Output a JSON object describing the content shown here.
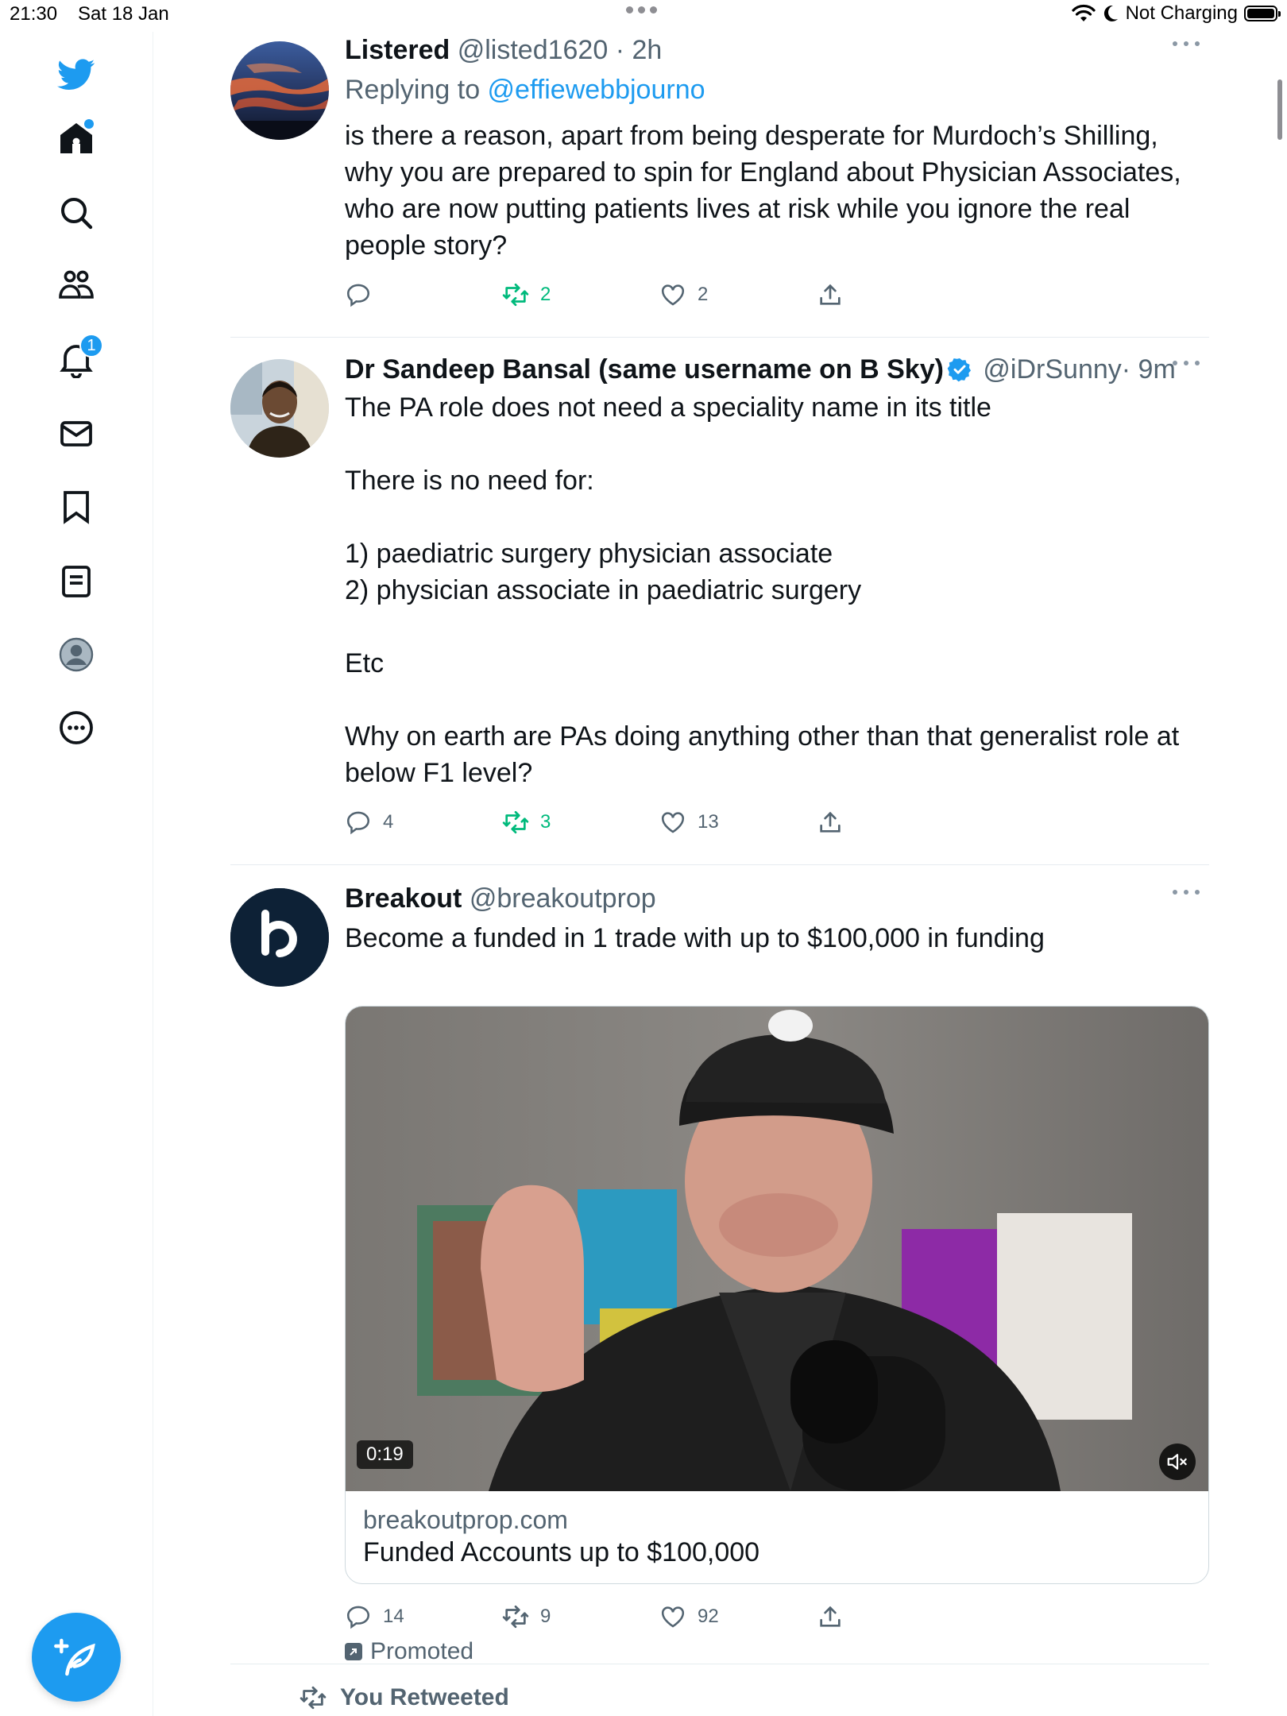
{
  "status_bar": {
    "time": "21:30",
    "date": "Sat 18 Jan",
    "battery": "Not Charging"
  },
  "sidebar": {
    "items": [
      {
        "name": "twitter-logo-icon"
      },
      {
        "name": "home-icon"
      },
      {
        "name": "search-icon"
      },
      {
        "name": "communities-icon"
      },
      {
        "name": "notifications-icon",
        "badge": "1"
      },
      {
        "name": "messages-icon"
      },
      {
        "name": "bookmarks-icon"
      },
      {
        "name": "lists-icon"
      },
      {
        "name": "profile-icon"
      },
      {
        "name": "more-icon"
      }
    ]
  },
  "colors": {
    "accent": "#1d9bf0",
    "retweet": "#00ba7c",
    "muted": "#536471"
  },
  "tweets": [
    {
      "name": "Listered",
      "handle": "@listed1620",
      "time": "· 2h",
      "replying_prefix": "Replying to ",
      "replying_to": "@effiewebbjourno",
      "text": "is there a reason, apart from being desperate for Murdoch’s Shilling, why you are prepared to spin for England about Physician Associates, who are now putting patients lives at risk while you ignore the real people story?",
      "replies": "",
      "retweets": "2",
      "likes": "2"
    },
    {
      "name": "Dr Sandeep Bansal (same username on B Sky)",
      "handle": "@iDrSunny",
      "time": "· 9m",
      "text": "The PA role does not need a speciality name in its title\n\nThere is no need for:\n\n1) paediatric surgery physician associate\n2) physician associate in paediatric surgery\n\nEtc\n\nWhy on earth are PAs doing anything other than that generalist role at below F1 level?",
      "replies": "4",
      "retweets": "3",
      "likes": "13"
    },
    {
      "name": "Breakout",
      "handle": "@breakoutprop",
      "text": "Become a funded in 1 trade with up to $100,000 in funding",
      "card_domain": "breakoutprop.com",
      "card_title": "Funded Accounts up to $100,000",
      "video_duration": "0:19",
      "replies": "14",
      "retweets": "9",
      "likes": "92",
      "promoted": "Promoted"
    }
  ],
  "next": {
    "retweeted_label": "You Retweeted"
  }
}
